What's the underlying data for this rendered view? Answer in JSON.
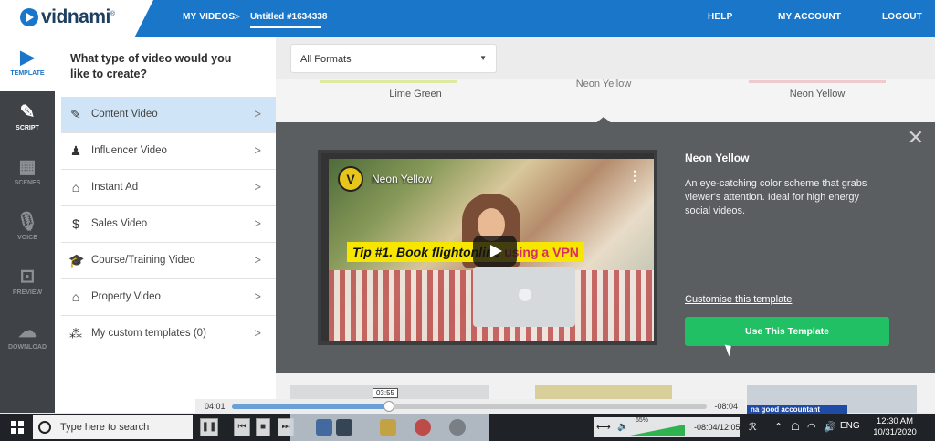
{
  "brand": {
    "name": "vidnami",
    "registered": "®"
  },
  "topnav": {
    "my_videos": "MY VIDEOS",
    "separator": ">",
    "current_project": "Untitled #1634338",
    "help": "HELP",
    "my_account": "MY ACCOUNT",
    "logout": "LOGOUT"
  },
  "rail": {
    "items": [
      {
        "label": "TEMPLATE",
        "icon": "play-square-icon"
      },
      {
        "label": "SCRIPT",
        "icon": "pen-icon"
      },
      {
        "label": "SCENES",
        "icon": "film-icon"
      },
      {
        "label": "VOICE",
        "icon": "microphone-icon"
      },
      {
        "label": "PREVIEW",
        "icon": "monitor-play-icon"
      },
      {
        "label": "DOWNLOAD",
        "icon": "cloud-download-icon"
      }
    ]
  },
  "panel": {
    "question": "What type of video would you like to create?",
    "categories": [
      {
        "label": "Content Video",
        "icon": "document-edit-icon"
      },
      {
        "label": "Influencer Video",
        "icon": "presenter-icon"
      },
      {
        "label": "Instant Ad",
        "icon": "tag-icon"
      },
      {
        "label": "Sales Video",
        "icon": "dollar-circle-icon"
      },
      {
        "label": "Course/Training Video",
        "icon": "graduation-cap-icon"
      },
      {
        "label": "Property Video",
        "icon": "house-icon"
      },
      {
        "label": "My custom templates (0)",
        "icon": "user-grid-icon"
      }
    ],
    "chevron": ">"
  },
  "filter": {
    "selected": "All Formats"
  },
  "top_thumbnails": [
    {
      "label": "Lime Green",
      "accent": "#c8e04a"
    },
    {
      "label": "Neon Yellow",
      "accent": "#f3e53a"
    },
    {
      "label": "Neon Yellow",
      "accent": "#e8a0a8"
    }
  ],
  "preview": {
    "video_title": "Neon Yellow",
    "caption_main": "Tip #1. Book flight",
    "caption_mid": "online ",
    "caption_accent": "using a VPN",
    "logo_glyph": "V"
  },
  "template_detail": {
    "title": "Neon Yellow",
    "description": "An eye-catching color scheme that grabs viewer's attention. Ideal for high energy social videos.",
    "customise_link": "Customise this template",
    "use_button": "Use This Template",
    "close": "✕"
  },
  "bottom_thumbnails": {
    "banner_text": "na good accountant"
  },
  "player": {
    "elapsed": "04:01",
    "remaining": "-08:04",
    "hover_time": "03:55",
    "progress": 0.33
  },
  "taskbar": {
    "search_placeholder": "Type here to search",
    "volume_percent": "65%",
    "media_time": "-08:04/12:05",
    "language": "ENG",
    "time": "12:30 AM",
    "date": "10/31/2020"
  },
  "colors": {
    "brand_blue": "#1976c9",
    "use_button_green": "#21c065",
    "active_category_bg": "#cfe4f6",
    "detail_bg": "#5b5e61"
  }
}
